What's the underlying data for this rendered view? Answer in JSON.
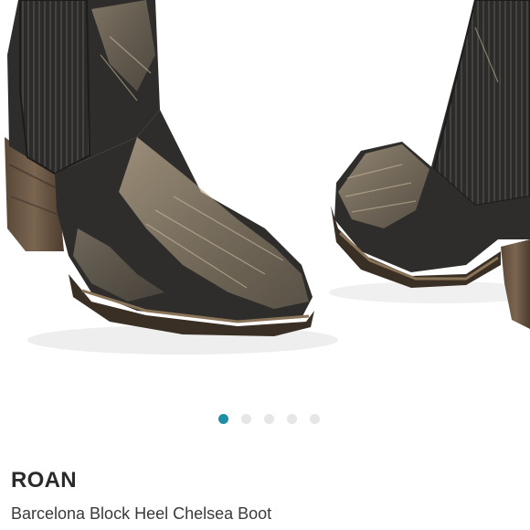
{
  "product": {
    "brand": "ROAN",
    "title": "Barcelona Block Heel Chelsea Boot",
    "image": {
      "icon": "product-photo-chelsea-boots",
      "leather_color": "#2e2d2b",
      "distress_color": "#c9b79a",
      "heel_color": "#6e5a45"
    }
  },
  "carousel": {
    "total_slides": 5,
    "active_index": 0,
    "active_color": "#1f8fa6",
    "inactive_color": "#e6e6e6"
  }
}
